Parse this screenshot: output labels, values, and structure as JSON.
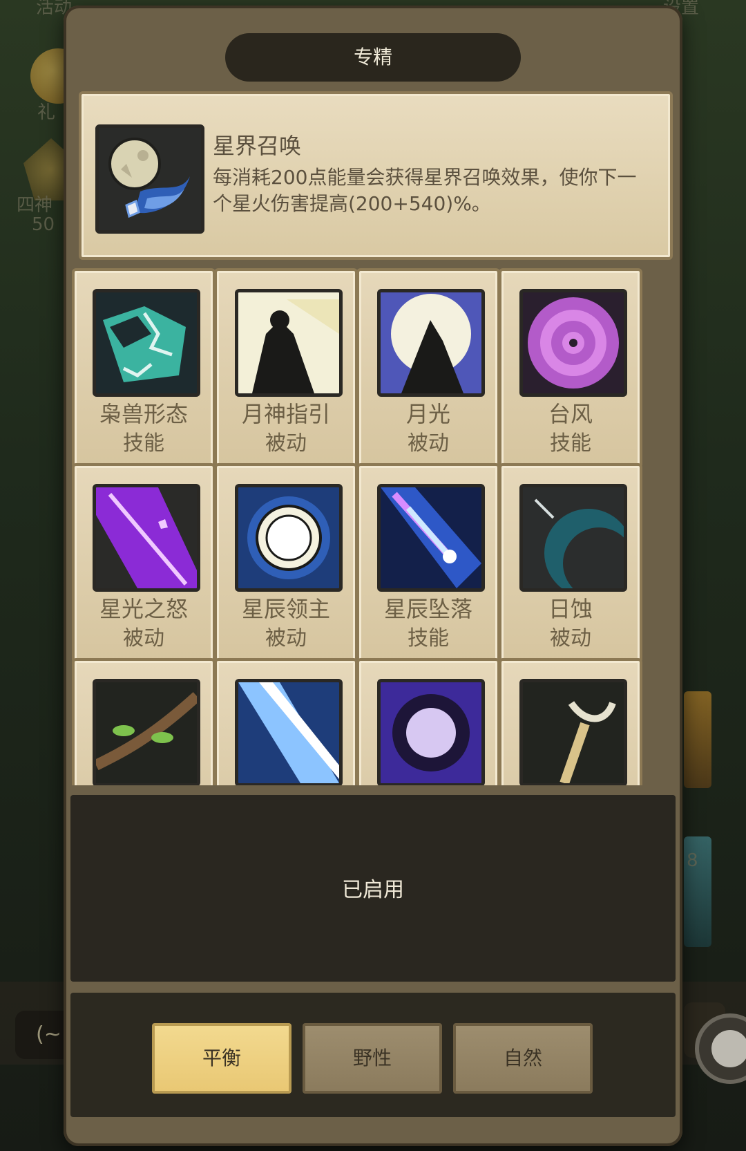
{
  "background": {
    "top_left_label": "活动",
    "top_right_label": "设置",
    "side_label_1": "礼",
    "side_label_2": "四神",
    "side_label_3": "50",
    "pill_label": "(~",
    "right_number": "8"
  },
  "header": {
    "title": "专精"
  },
  "selected_skill": {
    "name": "星界召唤",
    "description": "每消耗200点能量会获得星界召唤效果，使你下一个星火伤害提高(200+540)%。",
    "icon": "moon-comet-icon"
  },
  "skills": [
    {
      "name": "枭兽形态",
      "type": "技能",
      "icon": "owlbeast-form-icon"
    },
    {
      "name": "月神指引",
      "type": "被动",
      "icon": "moon-guidance-icon"
    },
    {
      "name": "月光",
      "type": "被动",
      "icon": "moonlight-icon"
    },
    {
      "name": "台风",
      "type": "技能",
      "icon": "typhoon-icon"
    },
    {
      "name": "星光之怒",
      "type": "被动",
      "icon": "starlight-wrath-icon"
    },
    {
      "name": "星辰领主",
      "type": "被动",
      "icon": "astral-lord-icon"
    },
    {
      "name": "星辰坠落",
      "type": "技能",
      "icon": "starfall-icon"
    },
    {
      "name": "日蚀",
      "type": "被动",
      "icon": "eclipse-icon"
    },
    {
      "name": "",
      "type": "",
      "icon": "vine-branch-icon"
    },
    {
      "name": "",
      "type": "",
      "icon": "light-beam-icon"
    },
    {
      "name": "",
      "type": "",
      "icon": "void-orb-icon"
    },
    {
      "name": "",
      "type": "",
      "icon": "moon-staff-icon"
    }
  ],
  "status": {
    "label": "已启用"
  },
  "tabs": [
    {
      "label": "平衡",
      "active": true
    },
    {
      "label": "野性",
      "active": false
    },
    {
      "label": "自然",
      "active": false
    }
  ],
  "colors": {
    "parchment": "#e6d8ba",
    "panel": "#6c6048",
    "dark": "#2a2720",
    "active_tab": "#f2d98f"
  }
}
